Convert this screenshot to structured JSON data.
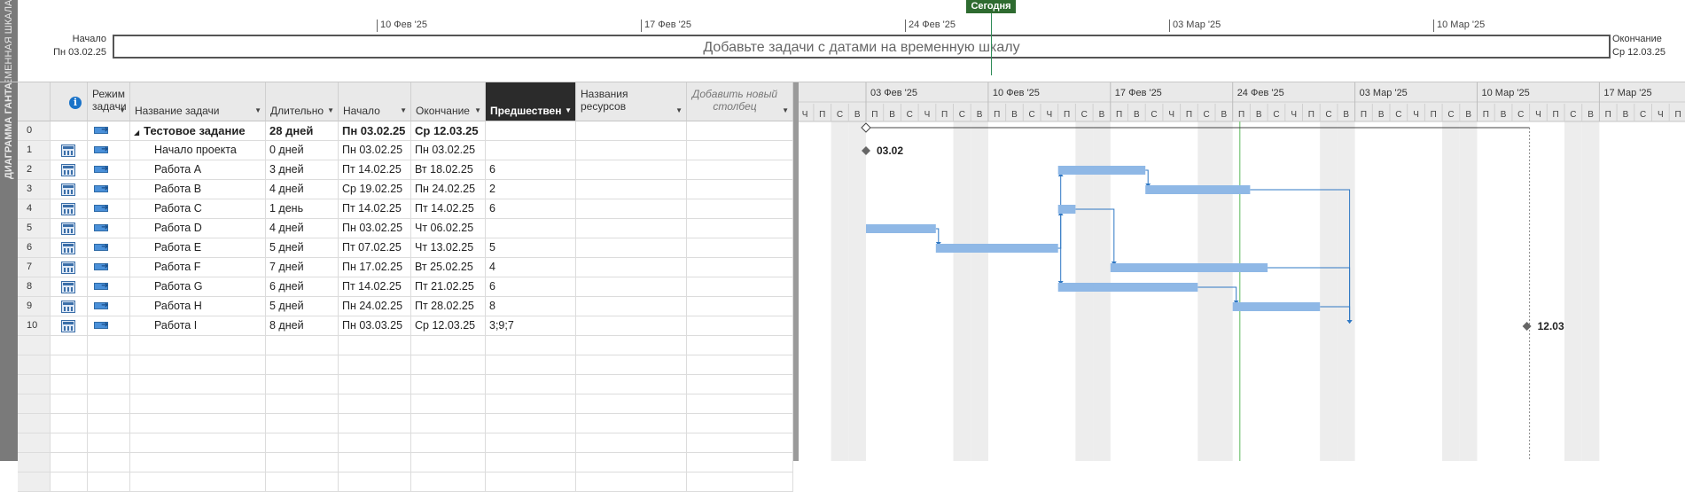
{
  "timeline": {
    "side_label": "ВРЕМЕННАЯ ШКАЛА",
    "start_label": "Начало",
    "start_date": "Пн 03.02.25",
    "end_label": "Окончание",
    "end_date": "Ср 12.03.25",
    "placeholder": "Добавьте задачи с датами на временную шкалу",
    "today_label": "Сегодня",
    "dates": [
      "10 Фев '25",
      "17 Фев '25",
      "24 Фев '25",
      "03 Мар '25",
      "10 Мар '25"
    ]
  },
  "view_label": "ДИАГРАММА ГАНТА",
  "columns": {
    "info": "i",
    "mode": "Режим задачи",
    "name": "Название задачи",
    "duration": "Длительность",
    "start": "Начало",
    "finish": "Окончание",
    "predecessors": "Предшественники",
    "resources": "Названия ресурсов",
    "add": "Добавить новый столбец"
  },
  "tasks": [
    {
      "id": "0",
      "name": "Тестовое задание",
      "duration": "28 дней",
      "start": "Пн 03.02.25",
      "finish": "Ср 12.03.25",
      "pred": "",
      "summary": true
    },
    {
      "id": "1",
      "name": "Начало проекта",
      "duration": "0 дней",
      "start": "Пн 03.02.25",
      "finish": "Пн 03.02.25",
      "pred": ""
    },
    {
      "id": "2",
      "name": "Работа A",
      "duration": "3 дней",
      "start": "Пт 14.02.25",
      "finish": "Вт 18.02.25",
      "pred": "6"
    },
    {
      "id": "3",
      "name": "Работа B",
      "duration": "4 дней",
      "start": "Ср 19.02.25",
      "finish": "Пн 24.02.25",
      "pred": "2"
    },
    {
      "id": "4",
      "name": "Работа C",
      "duration": "1 день",
      "start": "Пт 14.02.25",
      "finish": "Пт 14.02.25",
      "pred": "6"
    },
    {
      "id": "5",
      "name": "Работа D",
      "duration": "4 дней",
      "start": "Пн 03.02.25",
      "finish": "Чт 06.02.25",
      "pred": ""
    },
    {
      "id": "6",
      "name": "Работа E",
      "duration": "5 дней",
      "start": "Пт 07.02.25",
      "finish": "Чт 13.02.25",
      "pred": "5"
    },
    {
      "id": "7",
      "name": "Работа F",
      "duration": "7 дней",
      "start": "Пн 17.02.25",
      "finish": "Вт 25.02.25",
      "pred": "4"
    },
    {
      "id": "8",
      "name": "Работа G",
      "duration": "6 дней",
      "start": "Пт 14.02.25",
      "finish": "Пт 21.02.25",
      "pred": "6"
    },
    {
      "id": "9",
      "name": "Работа H",
      "duration": "5 дней",
      "start": "Пн 24.02.25",
      "finish": "Пт 28.02.25",
      "pred": "8"
    },
    {
      "id": "10",
      "name": "Работа I",
      "duration": "8 дней",
      "start": "Пн 03.03.25",
      "finish": "Ср 12.03.25",
      "pred": "3;9;7"
    }
  ],
  "gantt": {
    "weeks": [
      "03 Фев '25",
      "10 Фев '25",
      "17 Фев '25",
      "24 Фев '25",
      "03 Мар '25",
      "10 Мар '25",
      "17 Мар '25"
    ],
    "weekdays": [
      "П",
      "В",
      "С",
      "Ч",
      "П",
      "С",
      "В"
    ],
    "lead_days": [
      "Ч",
      "П",
      "С",
      "В"
    ],
    "milestone_start_label": "03.02",
    "milestone_end_label": "12.03",
    "colors": {
      "bar": "#8fb8e6",
      "link": "#2f78c4",
      "today": "#8fcf8f",
      "weekend": "#ededed"
    }
  }
}
